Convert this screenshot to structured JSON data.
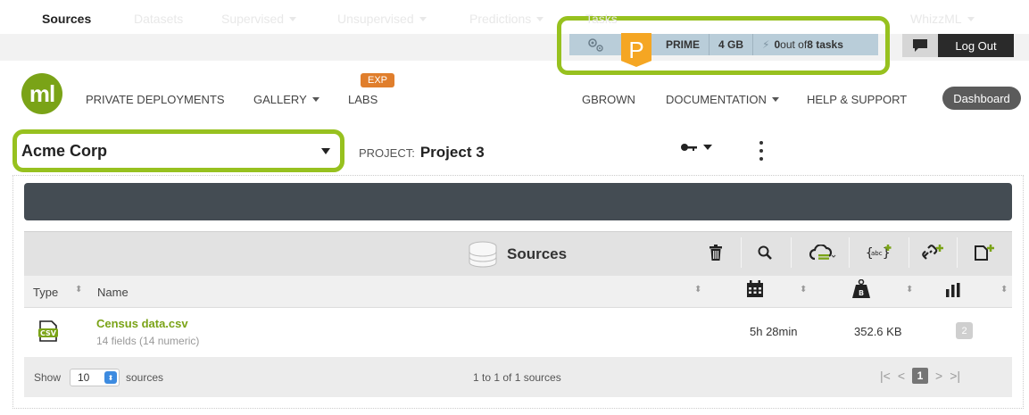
{
  "header": {
    "status": {
      "plan_letter": "P",
      "plan_name": "PRIME",
      "memory": "4 GB",
      "tasks_prefix": "0",
      "tasks_middle": " out of ",
      "tasks_total": "8 tasks"
    },
    "logout_label": "Log Out",
    "nav": {
      "private_deployments": "PRIVATE DEPLOYMENTS",
      "gallery": "GALLERY",
      "labs": "LABS",
      "labs_badge": "EXP",
      "user": "GBROWN",
      "documentation": "DOCUMENTATION",
      "help": "HELP & SUPPORT",
      "dashboard": "Dashboard"
    },
    "logo_text": "ml"
  },
  "context": {
    "organization": "Acme Corp",
    "project_label": "PROJECT:",
    "project_name": "Project 3"
  },
  "tabs": {
    "sources": "Sources",
    "datasets": "Datasets",
    "supervised": "Supervised",
    "unsupervised": "Unsupervised",
    "predictions": "Predictions",
    "tasks": "Tasks",
    "whizzml": "WhizzML"
  },
  "list": {
    "title": "Sources",
    "columns": {
      "type": "Type",
      "name": "Name"
    },
    "rows": [
      {
        "name": "Census data.csv",
        "subtitle": "14 fields (14 numeric)",
        "type_icon": "CSV",
        "age": "5h 28min",
        "size": "352.6 KB",
        "count": "2"
      }
    ],
    "footer": {
      "show_label": "Show",
      "page_size": "10",
      "sources_label": "sources",
      "range_text": "1 to 1 of 1 sources",
      "current_page": "1"
    }
  },
  "colors": {
    "highlight": "#97c11f",
    "brand": "#7aa317",
    "prime": "#f5a623",
    "tabbar": "#444c53"
  }
}
